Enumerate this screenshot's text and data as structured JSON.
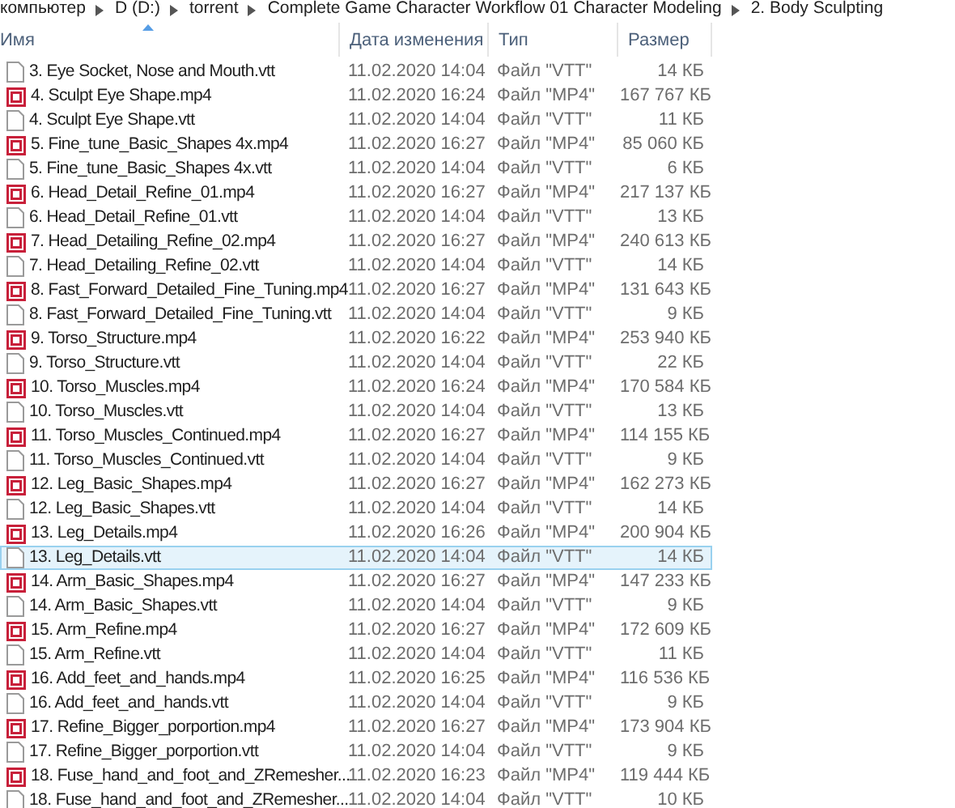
{
  "breadcrumb": [
    "компьютер",
    "D (D:)",
    "torrent",
    "Complete Game Character Workflow 01 Character Modeling",
    "2. Body Sculpting"
  ],
  "columns": [
    {
      "label": "Имя",
      "sorted": true
    },
    {
      "label": "Дата изменения",
      "sorted": false
    },
    {
      "label": "Тип",
      "sorted": false
    },
    {
      "label": "Размер",
      "sorted": false
    }
  ],
  "rows": [
    {
      "kind": "vtt",
      "name": "3. Eye Socket, Nose and Mouth.vtt",
      "date": "11.02.2020 14:04",
      "type": "Файл \"VTT\"",
      "size": "14 КБ",
      "selected": false
    },
    {
      "kind": "mp4",
      "name": "4. Sculpt Eye Shape.mp4",
      "date": "11.02.2020 16:24",
      "type": "Файл \"MP4\"",
      "size": "167 767 КБ",
      "selected": false
    },
    {
      "kind": "vtt",
      "name": "4. Sculpt Eye Shape.vtt",
      "date": "11.02.2020 14:04",
      "type": "Файл \"VTT\"",
      "size": "11 КБ",
      "selected": false
    },
    {
      "kind": "mp4",
      "name": "5. Fine_tune_Basic_Shapes 4x.mp4",
      "date": "11.02.2020 16:27",
      "type": "Файл \"MP4\"",
      "size": "85 060 КБ",
      "selected": false
    },
    {
      "kind": "vtt",
      "name": "5. Fine_tune_Basic_Shapes 4x.vtt",
      "date": "11.02.2020 14:04",
      "type": "Файл \"VTT\"",
      "size": "6 КБ",
      "selected": false
    },
    {
      "kind": "mp4",
      "name": "6. Head_Detail_Refine_01.mp4",
      "date": "11.02.2020 16:27",
      "type": "Файл \"MP4\"",
      "size": "217 137 КБ",
      "selected": false
    },
    {
      "kind": "vtt",
      "name": "6. Head_Detail_Refine_01.vtt",
      "date": "11.02.2020 14:04",
      "type": "Файл \"VTT\"",
      "size": "13 КБ",
      "selected": false
    },
    {
      "kind": "mp4",
      "name": "7. Head_Detailing_Refine_02.mp4",
      "date": "11.02.2020 16:27",
      "type": "Файл \"MP4\"",
      "size": "240 613 КБ",
      "selected": false
    },
    {
      "kind": "vtt",
      "name": "7. Head_Detailing_Refine_02.vtt",
      "date": "11.02.2020 14:04",
      "type": "Файл \"VTT\"",
      "size": "14 КБ",
      "selected": false
    },
    {
      "kind": "mp4",
      "name": "8. Fast_Forward_Detailed_Fine_Tuning.mp4",
      "date": "11.02.2020 16:27",
      "type": "Файл \"MP4\"",
      "size": "131 643 КБ",
      "selected": false
    },
    {
      "kind": "vtt",
      "name": "8. Fast_Forward_Detailed_Fine_Tuning.vtt",
      "date": "11.02.2020 14:04",
      "type": "Файл \"VTT\"",
      "size": "9 КБ",
      "selected": false
    },
    {
      "kind": "mp4",
      "name": "9. Torso_Structure.mp4",
      "date": "11.02.2020 16:22",
      "type": "Файл \"MP4\"",
      "size": "253 940 КБ",
      "selected": false
    },
    {
      "kind": "vtt",
      "name": "9. Torso_Structure.vtt",
      "date": "11.02.2020 14:04",
      "type": "Файл \"VTT\"",
      "size": "22 КБ",
      "selected": false
    },
    {
      "kind": "mp4",
      "name": "10. Torso_Muscles.mp4",
      "date": "11.02.2020 16:24",
      "type": "Файл \"MP4\"",
      "size": "170 584 КБ",
      "selected": false
    },
    {
      "kind": "vtt",
      "name": "10. Torso_Muscles.vtt",
      "date": "11.02.2020 14:04",
      "type": "Файл \"VTT\"",
      "size": "13 КБ",
      "selected": false
    },
    {
      "kind": "mp4",
      "name": "11. Torso_Muscles_Continued.mp4",
      "date": "11.02.2020 16:27",
      "type": "Файл \"MP4\"",
      "size": "114 155 КБ",
      "selected": false
    },
    {
      "kind": "vtt",
      "name": "11. Torso_Muscles_Continued.vtt",
      "date": "11.02.2020 14:04",
      "type": "Файл \"VTT\"",
      "size": "9 КБ",
      "selected": false
    },
    {
      "kind": "mp4",
      "name": "12. Leg_Basic_Shapes.mp4",
      "date": "11.02.2020 16:27",
      "type": "Файл \"MP4\"",
      "size": "162 273 КБ",
      "selected": false
    },
    {
      "kind": "vtt",
      "name": "12. Leg_Basic_Shapes.vtt",
      "date": "11.02.2020 14:04",
      "type": "Файл \"VTT\"",
      "size": "14 КБ",
      "selected": false
    },
    {
      "kind": "mp4",
      "name": "13. Leg_Details.mp4",
      "date": "11.02.2020 16:26",
      "type": "Файл \"MP4\"",
      "size": "200 904 КБ",
      "selected": false
    },
    {
      "kind": "vtt",
      "name": "13. Leg_Details.vtt",
      "date": "11.02.2020 14:04",
      "type": "Файл \"VTT\"",
      "size": "14 КБ",
      "selected": true
    },
    {
      "kind": "mp4",
      "name": "14. Arm_Basic_Shapes.mp4",
      "date": "11.02.2020 16:27",
      "type": "Файл \"MP4\"",
      "size": "147 233 КБ",
      "selected": false
    },
    {
      "kind": "vtt",
      "name": "14. Arm_Basic_Shapes.vtt",
      "date": "11.02.2020 14:04",
      "type": "Файл \"VTT\"",
      "size": "9 КБ",
      "selected": false
    },
    {
      "kind": "mp4",
      "name": "15. Arm_Refine.mp4",
      "date": "11.02.2020 16:27",
      "type": "Файл \"MP4\"",
      "size": "172 609 КБ",
      "selected": false
    },
    {
      "kind": "vtt",
      "name": "15. Arm_Refine.vtt",
      "date": "11.02.2020 14:04",
      "type": "Файл \"VTT\"",
      "size": "11 КБ",
      "selected": false
    },
    {
      "kind": "mp4",
      "name": "16. Add_feet_and_hands.mp4",
      "date": "11.02.2020 16:25",
      "type": "Файл \"MP4\"",
      "size": "116 536 КБ",
      "selected": false
    },
    {
      "kind": "vtt",
      "name": "16. Add_feet_and_hands.vtt",
      "date": "11.02.2020 14:04",
      "type": "Файл \"VTT\"",
      "size": "9 КБ",
      "selected": false
    },
    {
      "kind": "mp4",
      "name": "17. Refine_Bigger_porportion.mp4",
      "date": "11.02.2020 16:27",
      "type": "Файл \"MP4\"",
      "size": "173 904 КБ",
      "selected": false
    },
    {
      "kind": "vtt",
      "name": "17. Refine_Bigger_porportion.vtt",
      "date": "11.02.2020 14:04",
      "type": "Файл \"VTT\"",
      "size": "9 КБ",
      "selected": false
    },
    {
      "kind": "mp4",
      "name": "18. Fuse_hand_and_foot_and_ZRemesher...",
      "date": "11.02.2020 16:23",
      "type": "Файл \"MP4\"",
      "size": "119 444 КБ",
      "selected": false
    },
    {
      "kind": "vtt",
      "name": "18. Fuse_hand_and_foot_and_ZRemesher...",
      "date": "11.02.2020 14:04",
      "type": "Файл \"VTT\"",
      "size": "10 КБ",
      "selected": false
    }
  ]
}
